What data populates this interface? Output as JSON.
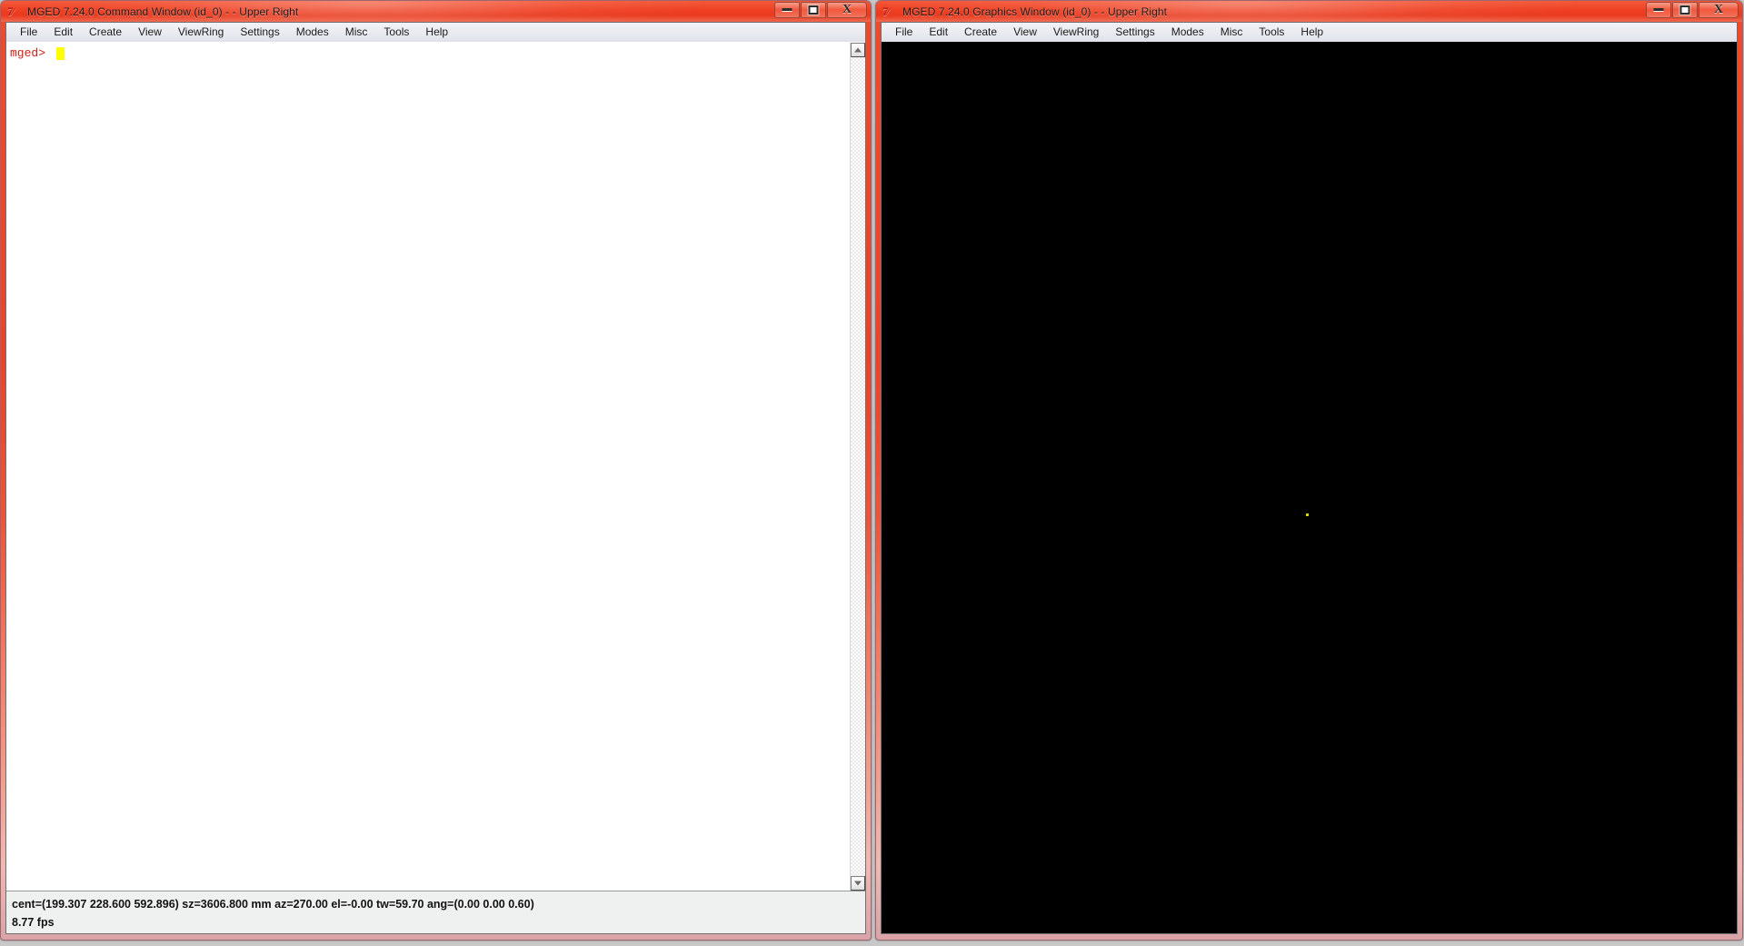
{
  "app": {
    "name": "MGED",
    "version": "7.24.0",
    "icon_glyph": "7⁄"
  },
  "menu_items": [
    "File",
    "Edit",
    "Create",
    "View",
    "ViewRing",
    "Settings",
    "Modes",
    "Misc",
    "Tools",
    "Help"
  ],
  "window_buttons": {
    "minimize_label": "Minimize",
    "maximize_label": "Maximize",
    "close_label": "Close",
    "close_glyph": "X"
  },
  "command_window": {
    "title": "MGED 7.24.0 Command Window (id_0) -  - Upper Right",
    "prompt": "mged>",
    "input_value": "",
    "scrollbar": {
      "up_arrow": "scroll-up",
      "down_arrow": "scroll-down"
    },
    "status": {
      "line1": "cent=(199.307 228.600 592.896)  sz=3606.800  mm  az=270.00  el=-0.00  tw=59.70  ang=(0.00 0.00 0.60)",
      "line2": "8.77 fps",
      "values": {
        "cent_x": 199.307,
        "cent_y": 228.6,
        "cent_z": 592.896,
        "size": 3606.8,
        "units": "mm",
        "azimuth": 270.0,
        "elevation": -0.0,
        "twist": 59.7,
        "ang_x": 0.0,
        "ang_y": 0.0,
        "ang_z": 0.6,
        "fps": "8.77 fps"
      }
    }
  },
  "graphics_window": {
    "title": "MGED 7.24.0 Graphics Window (id_0) -  - Upper Right",
    "canvas_background": "#000000",
    "center_marker_color": "#d8d800"
  },
  "colors": {
    "titlebar_accent": "#ee3f22",
    "frame_border": "#9c6670",
    "prompt_red": "#cf1f15",
    "caret_yellow": "#ffff00",
    "client_bg": "#eceef2",
    "status_bg": "#eff0f0"
  }
}
